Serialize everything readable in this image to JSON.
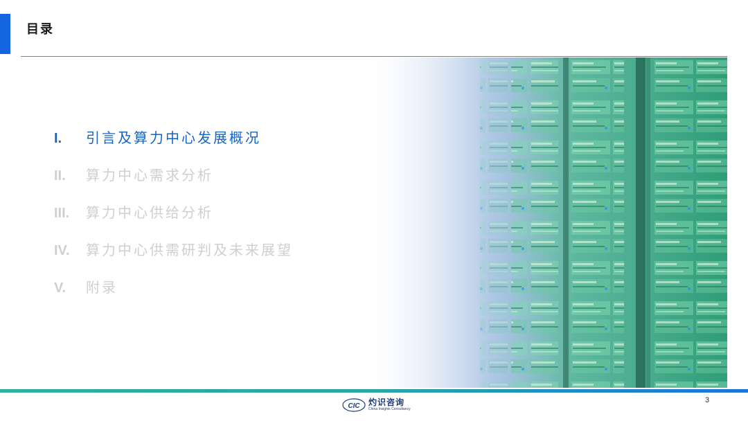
{
  "header": {
    "title": "目录"
  },
  "toc": {
    "items": [
      {
        "num": "I.",
        "label": "引言及算力中心发展概况",
        "active": true
      },
      {
        "num": "II.",
        "label": "算力中心需求分析",
        "active": false
      },
      {
        "num": "III.",
        "label": "算力中心供给分析",
        "active": false
      },
      {
        "num": "IV.",
        "label": "算力中心供需研判及未来展望",
        "active": false
      },
      {
        "num": "V.",
        "label": "附录",
        "active": false
      }
    ]
  },
  "hero": {
    "icon": "server-racks-image"
  },
  "footer": {
    "logo_mark": "CIC",
    "logo_cn": "灼识咨询",
    "logo_en": "China Insights Consultancy",
    "page_number": "3"
  },
  "colors": {
    "accent": "#1565e0",
    "active_text": "#1565c0",
    "inactive_text": "#cfcfcf",
    "teal": "#2fb09a"
  }
}
